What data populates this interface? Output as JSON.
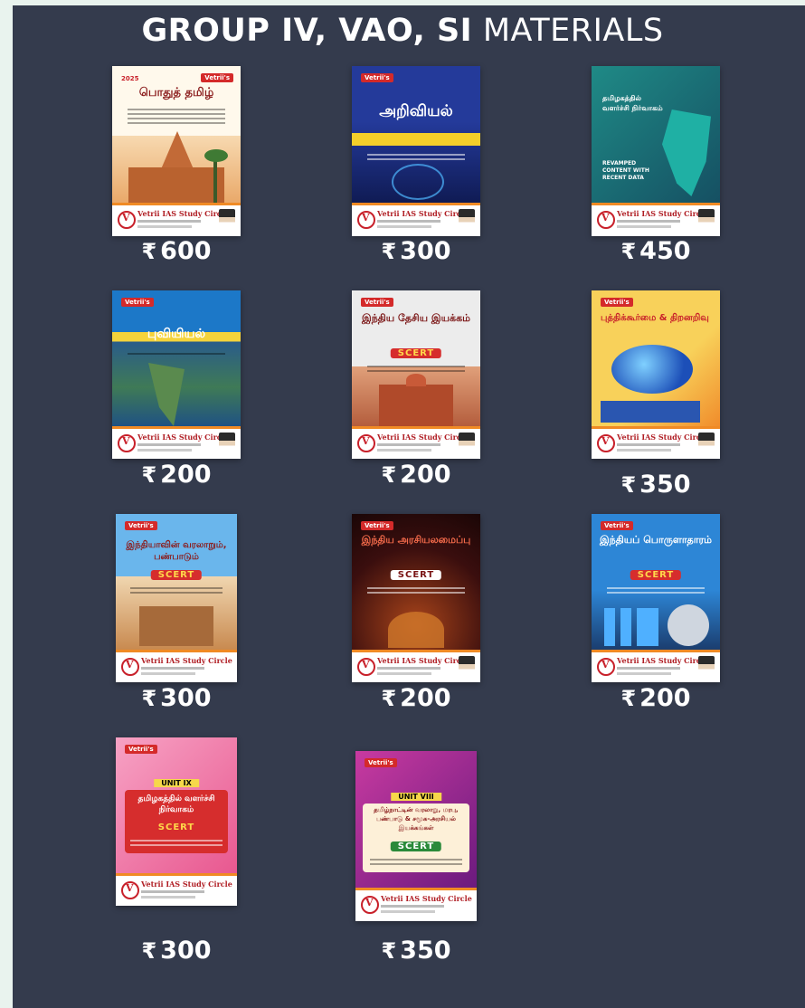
{
  "header": {
    "title_bold": "GROUP IV, VAO, SI",
    "title_light": "MATERIALS"
  },
  "currency_symbol": "₹",
  "publisher": {
    "brand": "Vetrii's",
    "name": "Vetrii IAS Study Circle"
  },
  "books": [
    {
      "title": "பொதுத் தமிழ்",
      "subtitle": "",
      "unit": "",
      "tag": "",
      "year": "2025",
      "price": "600",
      "price_symbol": "₹"
    },
    {
      "title": "அறிவியல்",
      "subtitle": "",
      "unit": "",
      "tag": "",
      "year": "",
      "price": "300",
      "price_symbol": "₹"
    },
    {
      "title": "தமிழகத்தில் வளர்ச்சி நிர்வாகம்",
      "subtitle": "REVAMPED CONTENT WITH RECENT DATA",
      "unit": "",
      "tag": "",
      "year": "",
      "price": "450",
      "price_symbol": "₹"
    },
    {
      "title": "புவியியல்",
      "subtitle": "",
      "unit": "",
      "tag": "",
      "year": "",
      "price": "200",
      "price_symbol": "₹"
    },
    {
      "title": "இந்திய தேசிய இயக்கம்",
      "subtitle": "",
      "unit": "",
      "tag": "SCERT",
      "year": "",
      "price": "200",
      "price_symbol": "₹"
    },
    {
      "title": "புத்திக்கூர்மை & திறனறிவு",
      "subtitle": "",
      "unit": "",
      "tag": "",
      "year": "",
      "price": "350",
      "price_symbol": "₹"
    },
    {
      "title": "இந்தியாவின் வரலாறும், பண்பாடும்",
      "subtitle": "",
      "unit": "",
      "tag": "SCERT",
      "year": "",
      "price": "300",
      "price_symbol": "₹"
    },
    {
      "title": "இந்திய அரசியலமைப்பு",
      "subtitle": "",
      "unit": "",
      "tag": "SCERT",
      "year": "",
      "price": "200",
      "price_symbol": "₹"
    },
    {
      "title": "இந்தியப் பொருளாதாரம்",
      "subtitle": "",
      "unit": "",
      "tag": "SCERT",
      "year": "",
      "price": "200",
      "price_symbol": "₹"
    },
    {
      "title": "தமிழகத்தில் வளர்ச்சி நிர்வாகம்",
      "subtitle": "",
      "unit": "UNIT IX",
      "tag": "SCERT",
      "year": "",
      "price": "300",
      "price_symbol": "₹"
    },
    {
      "title": "தமிழ்நாட்டின் வரலாறு, மரபு, பண்பாடு & சமூக-அரசியல் இயக்கங்கள்",
      "subtitle": "",
      "unit": "UNIT VIII",
      "tag": "SCERT",
      "year": "",
      "price": "350",
      "price_symbol": "₹"
    }
  ],
  "colors": {
    "panel_bg": "#343b4d",
    "outer_bg": "#e9f3ee",
    "price_text": "#ffffff",
    "footer_accent": "#f08a24"
  }
}
